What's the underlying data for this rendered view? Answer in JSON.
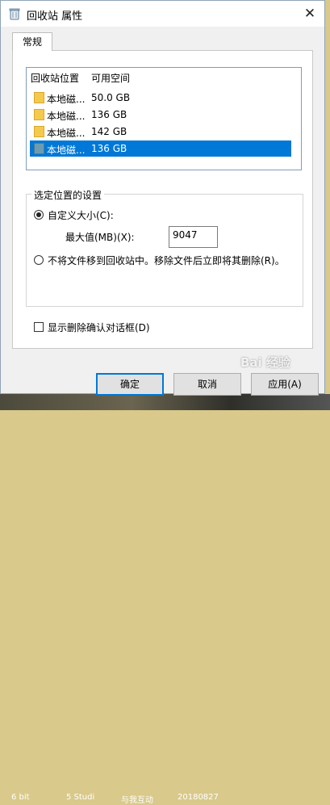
{
  "window": {
    "title": "回收站 属性",
    "title_icon": "recycle-bin-icon",
    "close_glyph": "✕"
  },
  "tabs": [
    {
      "label": "常规",
      "active": true
    }
  ],
  "locations": {
    "headers": [
      "回收站位置",
      "可用空间"
    ],
    "rows": [
      {
        "name": "本地磁...",
        "free_space": "50.0 GB",
        "selected": false,
        "icon": "folder-icon"
      },
      {
        "name": "本地磁...",
        "free_space": "136 GB",
        "selected": false,
        "icon": "folder-icon"
      },
      {
        "name": "本地磁...",
        "free_space": "142 GB",
        "selected": false,
        "icon": "folder-icon"
      },
      {
        "name": "本地磁...",
        "free_space": "136 GB",
        "selected": true,
        "icon": "drive-icon"
      }
    ]
  },
  "settings_group": {
    "title": "选定位置的设置",
    "custom_size_label": "自定义大小(C):",
    "custom_size_checked": true,
    "max_size_label": "最大值(MB)(X):",
    "max_size_value": "9047",
    "no_recycle_label": "不将文件移到回收站中。移除文件后立即将其删除(R)。",
    "no_recycle_checked": false
  },
  "confirm_dialog": {
    "label": "显示删除确认对话框(D)",
    "checked": false
  },
  "buttons": {
    "ok": "确定",
    "cancel": "取消",
    "apply": "应用(A)"
  },
  "watermark": "Bai 经验",
  "desktop_labels": [
    "6 bit",
    "5 Studi",
    "与我互动",
    "20180827"
  ],
  "colors": {
    "selection": "#0078d7",
    "dialog_bg": "#f0f0f0",
    "folder": "#f5c94e"
  }
}
